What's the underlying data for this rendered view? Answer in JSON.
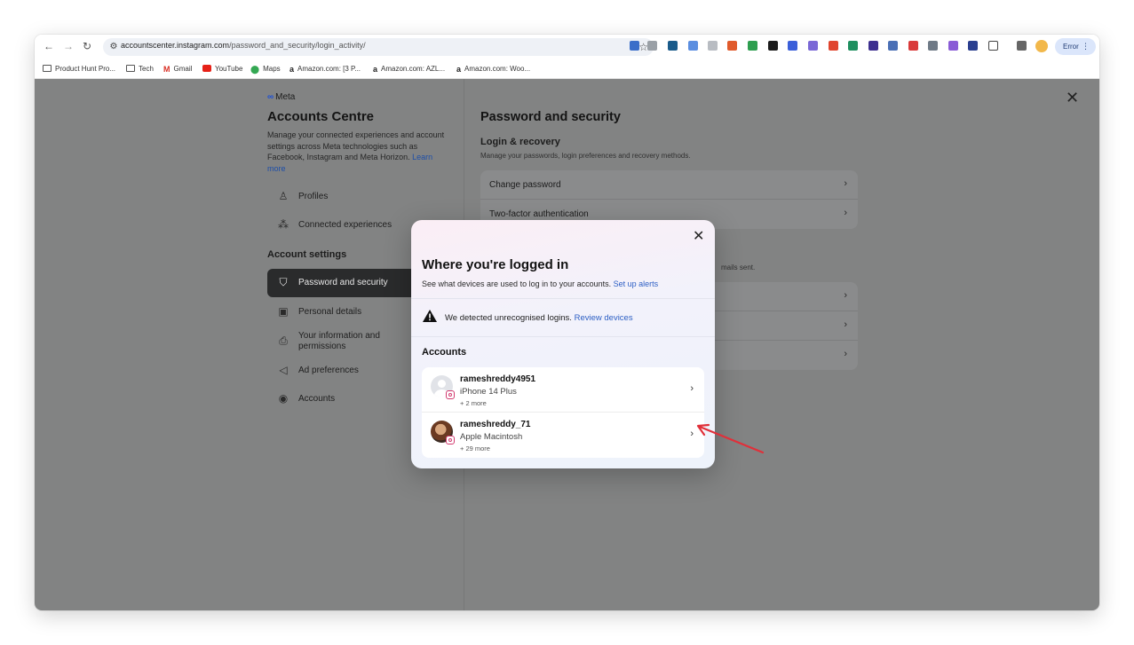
{
  "browser": {
    "url_host": "accountscenter.instagram.com",
    "url_path": "/password_and_security/login_activity/",
    "error_button": "Error",
    "bookmarks": [
      {
        "icon": "folder-icon",
        "label": "Product Hunt Pro..."
      },
      {
        "icon": "folder-icon",
        "label": "Tech"
      },
      {
        "icon": "gmail-icon",
        "label": "Gmail"
      },
      {
        "icon": "youtube-icon",
        "label": "YouTube"
      },
      {
        "icon": "maps-icon",
        "label": "Maps"
      },
      {
        "icon": "amazon-icon",
        "label": "Amazon.com: [3 P..."
      },
      {
        "icon": "amazon-icon",
        "label": "Amazon.com: AZL..."
      },
      {
        "icon": "amazon-icon",
        "label": "Amazon.com: Woo..."
      }
    ]
  },
  "sidebar": {
    "brand": "Meta",
    "title": "Accounts Centre",
    "description": "Manage your connected experiences and account settings across Meta technologies such as Facebook, Instagram and Meta Horizon.",
    "learn_more": "Learn more",
    "items": [
      {
        "icon": "person-icon",
        "label": "Profiles"
      },
      {
        "icon": "connected-icon",
        "label": "Connected experiences"
      }
    ],
    "section_label": "Account settings",
    "settings_items": [
      {
        "icon": "shield-icon",
        "label": "Password and security",
        "active": true
      },
      {
        "icon": "id-card-icon",
        "label": "Personal details"
      },
      {
        "icon": "info-lock-icon",
        "label": "Your information and permissions"
      },
      {
        "icon": "megaphone-icon",
        "label": "Ad preferences"
      },
      {
        "icon": "account-circle-icon",
        "label": "Accounts"
      }
    ]
  },
  "main": {
    "title": "Password and security",
    "login_recovery_title": "Login & recovery",
    "login_recovery_desc": "Manage your passwords, login preferences and recovery methods.",
    "login_rows": [
      "Change password",
      "Two-factor authentication"
    ],
    "emails_desc_fragment": "mails sent."
  },
  "modal": {
    "title": "Where you're logged in",
    "subtitle": "See what devices are used to log in to your accounts.",
    "subtitle_link": "Set up alerts",
    "warning": "We detected unrecognised logins.",
    "warning_link": "Review devices",
    "accounts_label": "Accounts",
    "accounts": [
      {
        "username": "rameshreddy4951",
        "device": "iPhone 14 Plus",
        "more": "+ 2 more",
        "avatar": "blank"
      },
      {
        "username": "rameshreddy_71",
        "device": "Apple Macintosh",
        "more": "+ 29 more",
        "avatar": "photo"
      }
    ]
  },
  "colors": {
    "link": "#2d5fc4",
    "annotation_arrow": "#e0303a",
    "active_menu": "#2a2b2c"
  }
}
